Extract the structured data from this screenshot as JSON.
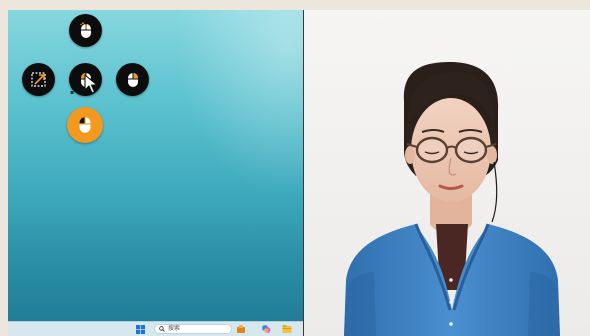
{
  "desktop": {
    "pie_menu": {
      "items": [
        {
          "name": "scroll-top",
          "icon": "mouse-scroll-icon"
        },
        {
          "name": "left-action",
          "icon": "resize-arrow-icon"
        },
        {
          "name": "center",
          "icon": "mouse-left-click-icon"
        },
        {
          "name": "right-action",
          "icon": "mouse-right-click-icon"
        },
        {
          "name": "bottom-action",
          "icon": "mouse-click-icon",
          "state": "active"
        }
      ]
    },
    "taskbar": {
      "search_placeholder": "搜索"
    }
  },
  "colors": {
    "accent": "#f39a1e",
    "button": "#0c0c0c",
    "desktop_top": "#86d7df",
    "desktop_bottom": "#1f7895",
    "cardigan": "#3f83c4"
  }
}
